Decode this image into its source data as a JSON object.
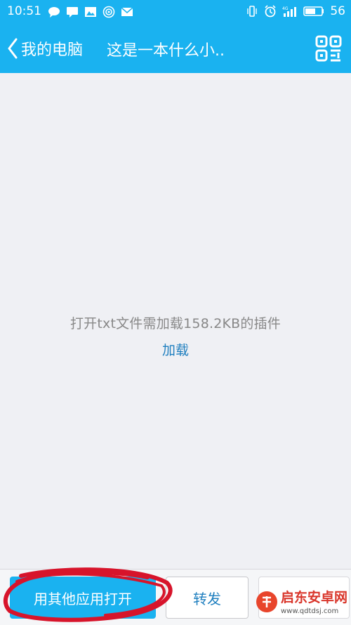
{
  "status_bar": {
    "time": "10:51",
    "battery": "56",
    "network": "4G",
    "left_icons": [
      "chat-icon",
      "message-icon",
      "image-icon",
      "hotspot-icon",
      "mail-icon"
    ],
    "right_icons": [
      "vibrate-icon",
      "alarm-icon",
      "signal-icon",
      "battery-icon"
    ]
  },
  "navbar": {
    "back_label": "我的电脑",
    "title": "这是一本什么小..",
    "qr_icon": "qr-scan-icon"
  },
  "content": {
    "message": "打开txt文件需加载158.2KB的插件",
    "load_link": "加载"
  },
  "bottom_bar": {
    "open_with_label": "用其他应用打开",
    "forward_label": "转发"
  },
  "watermark": {
    "brand": "启东安卓网",
    "url": "www.qdtdsj.com"
  },
  "colors": {
    "accent": "#1ab2f0",
    "link": "#1f7fbf",
    "background": "#eff0f4",
    "annotation": "#d7142b"
  }
}
